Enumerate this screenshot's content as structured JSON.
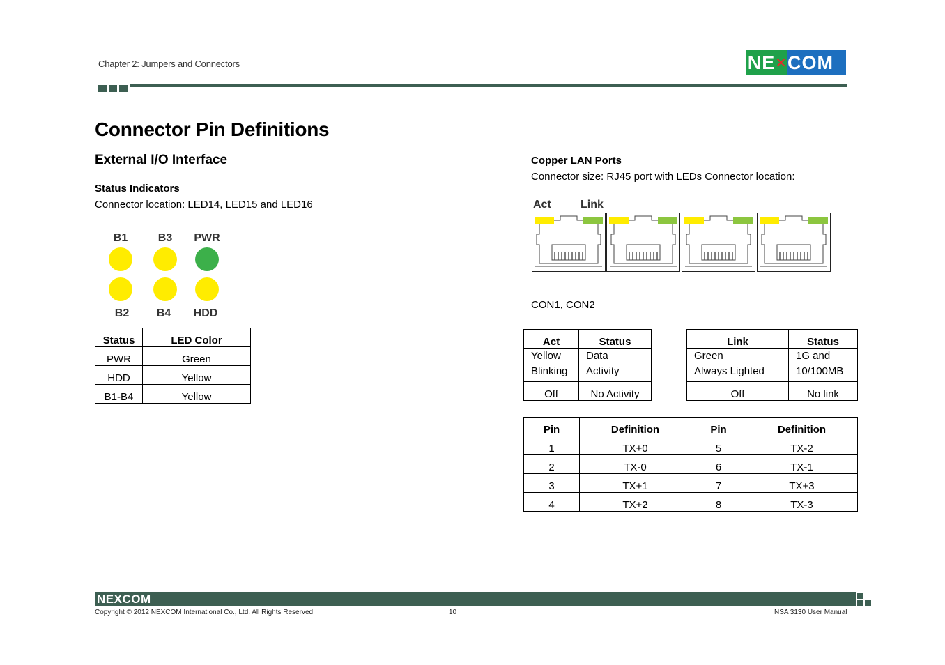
{
  "header": {
    "chapter": "Chapter 2: Jumpers and Connectors",
    "logo": {
      "left": "NE",
      "right": "COM",
      "green": "#1fa14a",
      "blue": "#1d6fbf"
    }
  },
  "page_title": "Connector Pin Definitions",
  "left": {
    "section_title": "External I/O Interface",
    "status_indicators": {
      "title": "Status Indicators",
      "location": "Connector location: LED14, LED15 and LED16",
      "leds_top": [
        {
          "label": "B1",
          "color": "#ffec00"
        },
        {
          "label": "B3",
          "color": "#ffec00"
        },
        {
          "label": "PWR",
          "color": "#3cb04a"
        }
      ],
      "leds_bottom": [
        {
          "label": "B2",
          "color": "#ffec00"
        },
        {
          "label": "B4",
          "color": "#ffec00"
        },
        {
          "label": "HDD",
          "color": "#ffec00"
        }
      ],
      "table": {
        "headers": [
          "Status",
          "LED Color"
        ],
        "rows": [
          [
            "PWR",
            "Green"
          ],
          [
            "HDD",
            "Yellow"
          ],
          [
            "B1-B4",
            "Yellow"
          ]
        ]
      }
    }
  },
  "right": {
    "copper_lan": {
      "title": "Copper LAN Ports",
      "description": "Connector size: RJ45 port with LEDs Connector location:",
      "diagram_labels": {
        "act": "Act",
        "link": "Link"
      },
      "port_count": 4,
      "connectors": "CON1, CON2"
    },
    "act_table": {
      "headers": [
        "Act",
        "Status"
      ],
      "rows": [
        [
          "Yellow Blinking",
          "Data Activity"
        ],
        [
          "Off",
          "No Activity"
        ]
      ],
      "row0": {
        "a1": "Yellow",
        "a2": "Blinking",
        "b1": "Data",
        "b2": "Activity"
      }
    },
    "link_table": {
      "headers": [
        "Link",
        "Status"
      ],
      "rows": [
        [
          "Green Always Lighted",
          "1G and 10/100MB"
        ],
        [
          "Off",
          "No link"
        ]
      ],
      "row0": {
        "a1": "Green",
        "a2": "Always Lighted",
        "b1": "1G and",
        "b2": "10/100MB"
      }
    },
    "pin_table": {
      "headers": [
        "Pin",
        "Definition",
        "Pin",
        "Definition"
      ],
      "rows": [
        [
          "1",
          "TX+0",
          "5",
          "TX-2"
        ],
        [
          "2",
          "TX-0",
          "6",
          "TX-1"
        ],
        [
          "3",
          "TX+1",
          "7",
          "TX+3"
        ],
        [
          "4",
          "TX+2",
          "8",
          "TX-3"
        ]
      ]
    }
  },
  "footer": {
    "logo": "NEXCOM",
    "copyright": "Copyright © 2012 NEXCOM International Co., Ltd. All Rights Reserved.",
    "page_number": "10",
    "manual": "NSA 3130 User Manual"
  }
}
